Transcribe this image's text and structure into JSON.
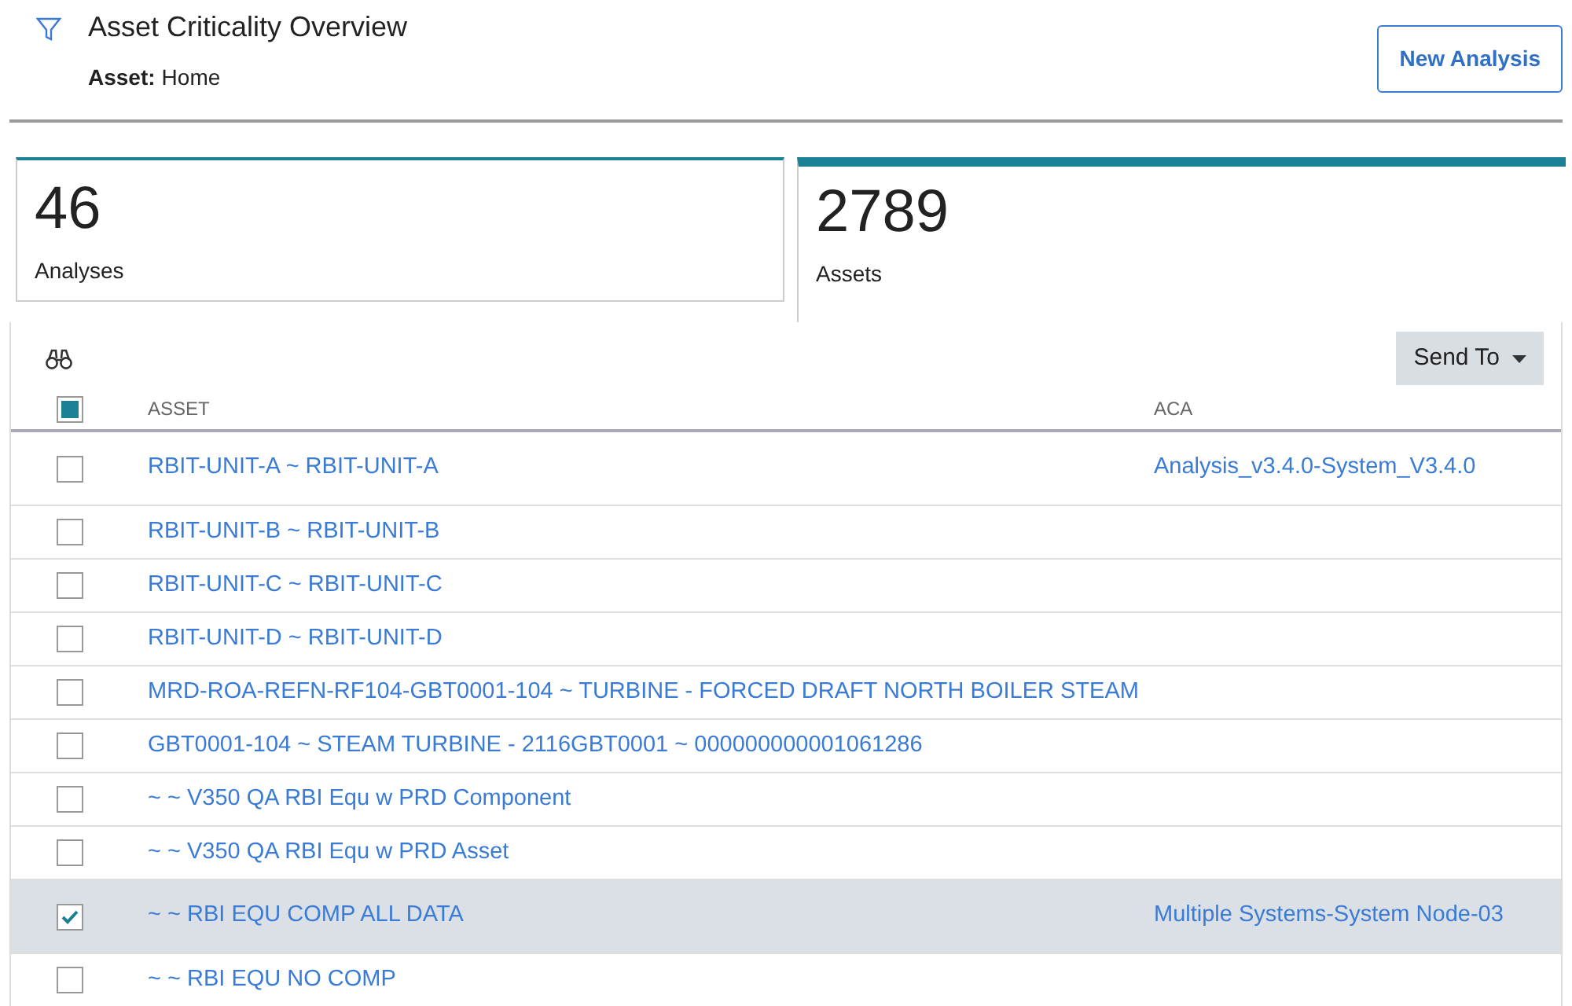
{
  "header": {
    "title": "Asset Criticality Overview",
    "asset_label": "Asset:",
    "asset_value": "Home",
    "new_button": "New Analysis"
  },
  "tiles": [
    {
      "count": "46",
      "label": "Analyses",
      "selected": false
    },
    {
      "count": "2789",
      "label": "Assets",
      "selected": true
    }
  ],
  "table": {
    "send_to": "Send To",
    "select_all_partial": true,
    "columns": [
      "ASSET",
      "ACA"
    ],
    "rows": [
      {
        "asset": "RBIT-UNIT-A ~ RBIT-UNIT-A",
        "aca": "Analysis_v3.4.0-System_V3.4.0",
        "selected": false
      },
      {
        "asset": "RBIT-UNIT-B ~ RBIT-UNIT-B",
        "selected": false
      },
      {
        "asset": "RBIT-UNIT-C ~ RBIT-UNIT-C",
        "selected": false
      },
      {
        "asset": "RBIT-UNIT-D ~ RBIT-UNIT-D",
        "selected": false
      },
      {
        "asset": "MRD-ROA-REFN-RF104-GBT0001-104 ~ TURBINE - FORCED DRAFT NORTH BOILER STEAM",
        "selected": false
      },
      {
        "asset": "GBT0001-104 ~ STEAM TURBINE - 2116GBT0001 ~ 000000000001061286",
        "selected": false
      },
      {
        "asset": "~ ~ V350 QA RBI Equ w PRD Component",
        "selected": false
      },
      {
        "asset": "~ ~ V350 QA RBI Equ w PRD Asset",
        "selected": false
      },
      {
        "asset": "~ ~ RBI EQU COMP ALL DATA",
        "aca": "Multiple Systems-System Node-03",
        "selected": true
      },
      {
        "asset": "~ ~ RBI EQU NO COMP",
        "selected": false
      }
    ]
  }
}
